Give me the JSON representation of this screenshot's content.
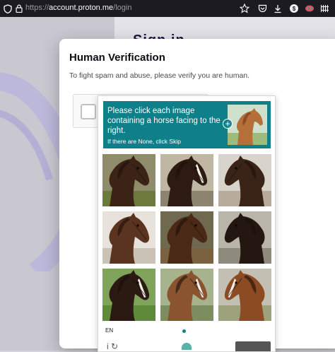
{
  "browser": {
    "url_protocol": "https://",
    "url_domain": "account.proton.me",
    "url_path": "/login",
    "extension_badge": "$"
  },
  "background": {
    "heading": "Sign in"
  },
  "modal": {
    "title": "Human Verification",
    "subtitle": "To fight spam and abuse, please verify you are human."
  },
  "captcha": {
    "prompt": "Please click each image containing a horse facing to the right.",
    "prompt_sub": "If there are None, click Skip",
    "language": "EN",
    "accent_color": "#0f7f8a",
    "tiles": [
      {
        "id": "horse-1"
      },
      {
        "id": "horse-2"
      },
      {
        "id": "horse-3"
      },
      {
        "id": "horse-4"
      },
      {
        "id": "horse-5"
      },
      {
        "id": "horse-6"
      },
      {
        "id": "horse-7"
      },
      {
        "id": "horse-8"
      },
      {
        "id": "horse-9"
      }
    ]
  }
}
